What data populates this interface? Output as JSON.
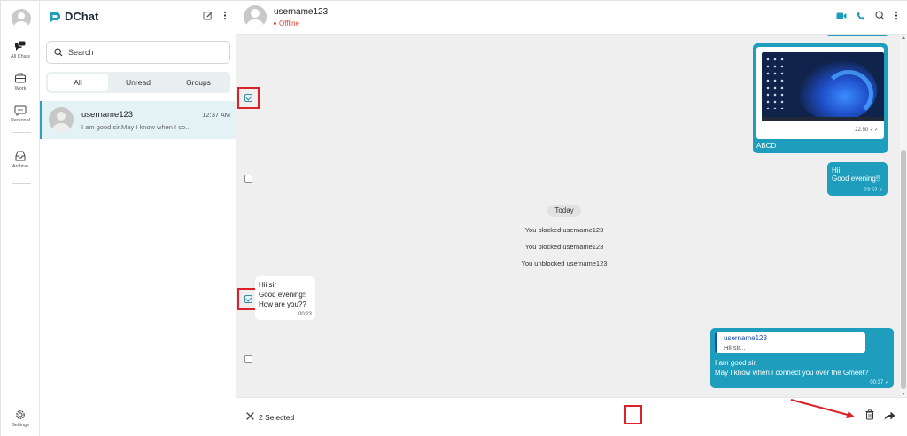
{
  "app": {
    "name": "DChat"
  },
  "rail": {
    "items": [
      {
        "label": "All Chats",
        "icon": "chats-icon"
      },
      {
        "label": "Work",
        "icon": "briefcase-icon"
      },
      {
        "label": "Personal",
        "icon": "message-icon"
      },
      {
        "label": "Archive",
        "icon": "archive-icon"
      },
      {
        "label": "Settings",
        "icon": "gear-icon"
      }
    ]
  },
  "list": {
    "search_placeholder": "Search",
    "tabs": [
      {
        "label": "All",
        "active": true
      },
      {
        "label": "Unread"
      },
      {
        "label": "Groups"
      }
    ],
    "conversations": [
      {
        "name": "username123",
        "time": "12:37 AM",
        "preview": "I am good sir.May I know when I co..."
      }
    ]
  },
  "chat": {
    "contact_name": "username123",
    "status": "Offline",
    "messages": {
      "image": {
        "caption": "ABCD",
        "time": "22:50"
      },
      "hi": {
        "line1": "Hii",
        "line2": "Good evening!!",
        "time": "23:52"
      },
      "date": "Today",
      "system": [
        "You blocked username123",
        "You blocked username123",
        "You unblocked username123"
      ],
      "incoming": {
        "line1": "Hii sir",
        "line2": "Good evening!!",
        "line3": "How are you??",
        "time": "00:23"
      },
      "reply": {
        "quote_name": "username123",
        "quote_text": "Hii sir...",
        "line1": "I am good sir.",
        "line2": "May I know when I connect you over the Gmeet?",
        "time": "00:37"
      }
    },
    "selection": {
      "label": "2 Selected"
    }
  },
  "colors": {
    "accent": "#1e9dbd",
    "offline": "#e0433a",
    "highlight": "#d9222a"
  }
}
